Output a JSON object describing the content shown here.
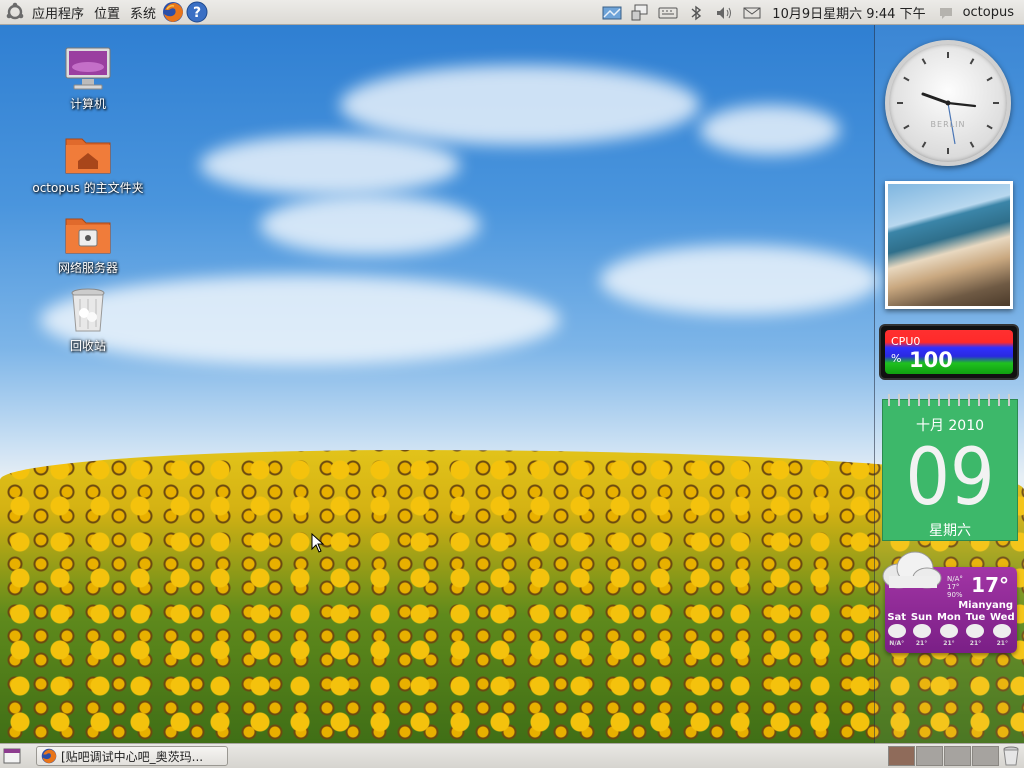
{
  "top_panel": {
    "applications": "应用程序",
    "places": "位置",
    "system": "系统",
    "datetime": "10月9日星期六  9:44 下午",
    "user": "octopus",
    "icons": [
      "ubuntu-logo-icon",
      "firefox-icon",
      "help-icon",
      "network-icon",
      "display-icon",
      "keyboard-icon",
      "bluetooth-icon",
      "volume-icon",
      "mail-icon",
      "chat-icon"
    ]
  },
  "desktop": {
    "icons": [
      {
        "label": "计算机",
        "icon": "computer-icon"
      },
      {
        "label": "octopus 的主文件夹",
        "icon": "home-folder-icon"
      },
      {
        "label": "网络服务器",
        "icon": "network-server-icon"
      },
      {
        "label": "回收站",
        "icon": "trash-icon"
      }
    ]
  },
  "widgets": {
    "clock": {
      "city": "BERLIN"
    },
    "cpu": {
      "label": "CPU0",
      "percent_symbol": "%",
      "value": "100"
    },
    "calendar": {
      "month_year": "十月 2010",
      "day": "09",
      "weekday": "星期六"
    },
    "weather": {
      "temp": "17°",
      "details": [
        "N/A°",
        "17°",
        "90%"
      ],
      "city": "Mianyang",
      "days": [
        {
          "name": "Sat",
          "lo": "N/A°"
        },
        {
          "name": "Sun",
          "lo": "21°"
        },
        {
          "name": "Mon",
          "lo": "21°"
        },
        {
          "name": "Tue",
          "lo": "21°"
        },
        {
          "name": "Wed",
          "lo": "21°"
        }
      ]
    }
  },
  "bottom_panel": {
    "task_title": "[贴吧调试中心吧_奥茨玛...",
    "workspaces": 4
  },
  "colors": {
    "panel_bg": "#dcdad5",
    "sky": "#4a95dd",
    "calendar_green": "#3db86a",
    "weather_purple": "#a235a5"
  }
}
